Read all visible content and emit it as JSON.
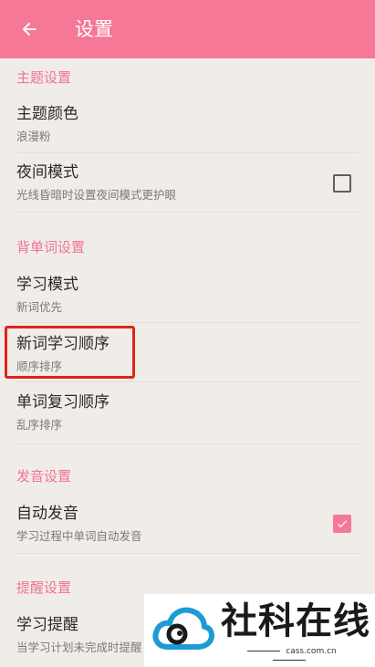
{
  "appbar": {
    "title": "设置",
    "back_icon": "arrow-left-icon",
    "color": "#F67897"
  },
  "sections": {
    "theme": {
      "header": "主题设置",
      "items": [
        {
          "title": "主题颜色",
          "summary": "浪漫粉"
        },
        {
          "title": "夜间模式",
          "summary": "光线昏暗时设置夜间模式更护眼",
          "checked": false
        }
      ]
    },
    "words": {
      "header": "背单词设置",
      "items": [
        {
          "title": "学习模式",
          "summary": "新词优先"
        },
        {
          "title": "新词学习顺序",
          "summary": "顺序排序"
        },
        {
          "title": "单词复习顺序",
          "summary": "乱序排序"
        }
      ]
    },
    "pronunciation": {
      "header": "发音设置",
      "items": [
        {
          "title": "自动发音",
          "summary": "学习过程中单词自动发音",
          "checked": true
        }
      ]
    },
    "reminder": {
      "header": "提醒设置",
      "items": [
        {
          "title": "学习提醒",
          "summary": "当学习计划未完成时提醒"
        }
      ]
    }
  },
  "watermark": {
    "text": "社科在线",
    "url": "cass.com.cn"
  }
}
